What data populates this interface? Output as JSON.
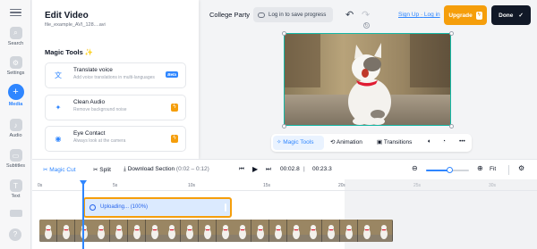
{
  "nav": {
    "items": [
      {
        "label": "Search",
        "icon": "search-icon"
      },
      {
        "label": "Settings",
        "icon": "gear-icon"
      },
      {
        "label": "Media",
        "icon": "plus-icon",
        "active": true
      },
      {
        "label": "Audio",
        "icon": "music-icon"
      },
      {
        "label": "Subtitles",
        "icon": "subtitles-icon"
      },
      {
        "label": "Text",
        "icon": "text-icon"
      },
      {
        "label": "",
        "icon": "elements-icon"
      }
    ],
    "help": "?"
  },
  "panel": {
    "title": "Edit Video",
    "filename": "file_example_AVI_128....avi",
    "section_title": "Magic Tools",
    "section_sparkle": "✨",
    "tools": [
      {
        "name": "Translate voice",
        "desc": "Add voice translations in multi-languages",
        "badge": "Beta",
        "icon": "translate-icon"
      },
      {
        "name": "Clean Audio",
        "desc": "Remove background noise",
        "badge": "bolt",
        "icon": "sparkle-icon"
      },
      {
        "name": "Eye Contact",
        "desc": "Always look at the camera",
        "badge": "bolt",
        "icon": "eye-icon"
      }
    ]
  },
  "header": {
    "project_name": "College Party",
    "save_label": "Log in to save progress",
    "signup": "Sign Up",
    "separator": "·",
    "login": "Log in",
    "upgrade": "Upgrade",
    "done": "Done"
  },
  "preview_toolbar": {
    "magic_tools": "Magic Tools",
    "animation": "Animation",
    "transitions": "Transitions",
    "more": "•••"
  },
  "timeline": {
    "magic_cut": "Magic Cut",
    "split": "Split",
    "download_section": "Download Section",
    "section_range": "(0:02 – 0:12)",
    "current_time": "00:02.8",
    "divider": "|",
    "total_time": "00:23.3",
    "fit": "Fit",
    "zoom_level": 0.55,
    "ruler": [
      "0s",
      "5s",
      "10s",
      "15s",
      "20s",
      "25s",
      "30s"
    ],
    "uploading_label": "Uploading... (100%)",
    "playhead_time_s": 2.8
  },
  "colors": {
    "accent": "#2f86ff",
    "upgrade": "#f59e0b",
    "done": "#111827",
    "selection": "#14b8a6"
  }
}
